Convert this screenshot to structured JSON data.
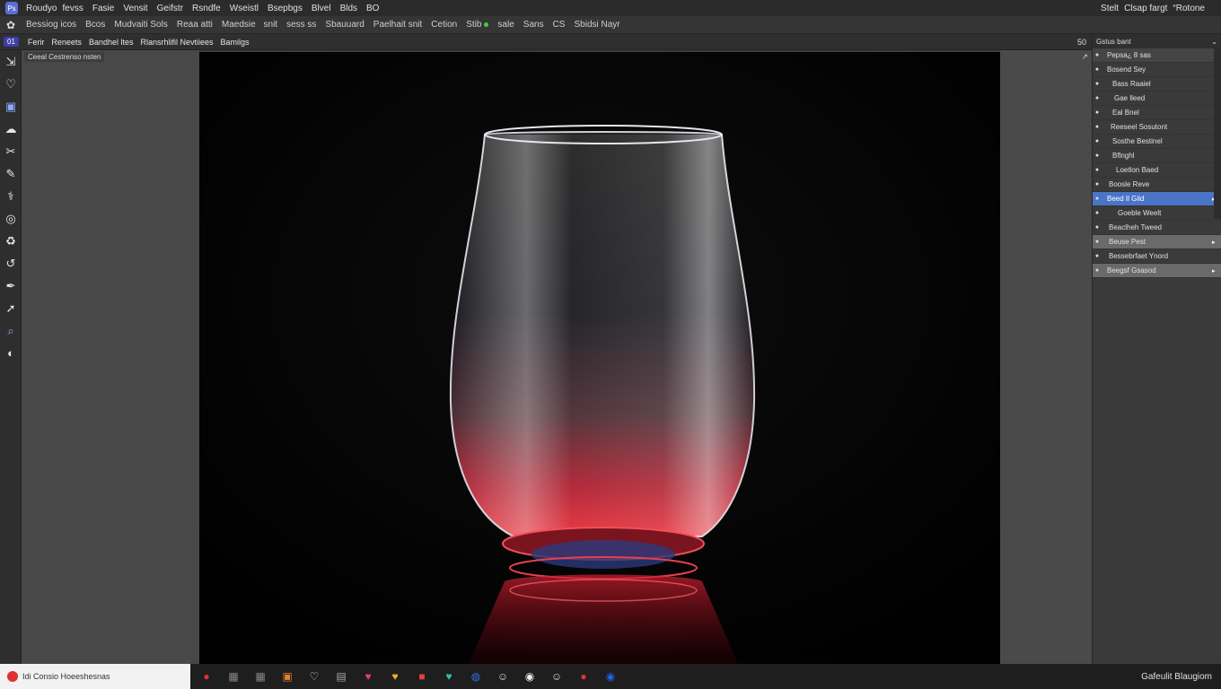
{
  "menubar": {
    "app_icon": "ps-icon",
    "items": [
      "Roudyofevss",
      "Fasie",
      "Vensit",
      "Geifstr",
      "Rsndfe",
      "Wseistl",
      "Bsepbgs",
      "Blvel",
      "Blds",
      "BO"
    ],
    "right": [
      "Stelt",
      "Clsap fargt",
      "“Rotone"
    ]
  },
  "options": {
    "items": [
      "Bessiog icos",
      "Bcos",
      "Mudvaiti Sols",
      "Reaa atti",
      "Maedsie snit",
      "sess ss",
      "Sbauuard",
      "Paelhait snit",
      "Cetion",
      "Stib",
      "sale",
      "Sans",
      "CS",
      "Sbidsi Nayr"
    ]
  },
  "tabs": {
    "doc_tag": "01",
    "items": [
      "Ferir",
      "Reneets",
      "Bandhel ltes",
      "Rlansrhlifil Nevtiiees",
      "Bamilgs"
    ],
    "zoom": "50"
  },
  "left_panel": {
    "tab_label": "Ceeal Cestrenso nsten"
  },
  "right_gap": {
    "corner": "↗"
  },
  "layers": {
    "header": "Gstus bant",
    "rows": [
      {
        "label": "Pepsa¿ 8 sas",
        "style": "head2",
        "indent": 6
      },
      {
        "label": "Bosend Sey",
        "style": "",
        "indent": 6
      },
      {
        "label": "Bass Raaiel",
        "style": "",
        "indent": 12
      },
      {
        "label": "Gae lleed",
        "style": "",
        "indent": 14
      },
      {
        "label": "Eal Bnel",
        "style": "",
        "indent": 12
      },
      {
        "label": "Reeseel Sosutont",
        "style": "",
        "indent": 10
      },
      {
        "label": "Sosthe Bestinel",
        "style": "",
        "indent": 12
      },
      {
        "label": "Bflnghl",
        "style": "",
        "indent": 12
      },
      {
        "label": "Loetlon Baed",
        "style": "",
        "indent": 16
      },
      {
        "label": "Boosle Reve",
        "style": "",
        "indent": 8
      },
      {
        "label": "Beed Il Gild",
        "style": "blue",
        "indent": 6
      },
      {
        "label": "Goeble Weelt",
        "style": "",
        "indent": 18
      },
      {
        "label": "Beaclheh Tweed",
        "style": "",
        "indent": 8
      },
      {
        "label": "Beuse Pest",
        "style": "gray",
        "indent": 8
      },
      {
        "label": "Bessebrfaet Ynord",
        "style": "",
        "indent": 8
      },
      {
        "label": "Beegsf Gsasod",
        "style": "gray",
        "indent": 6
      }
    ]
  },
  "taskbar": {
    "search_text": "Idi Consio Hoeeshesnas",
    "apps": [
      "red-circle-icon",
      "grid-icon",
      "grid2-icon",
      "orange-box-icon",
      "heart-icon",
      "doc-icon",
      "red-heart-icon",
      "yellow-heart-icon",
      "red-square-icon",
      "teal-heart-icon",
      "blue-globe-icon",
      "cat-icon",
      "chat-icon",
      "cat2-icon",
      "red-pin-icon",
      "blue-circle-icon"
    ],
    "tray": "Gafeulit Blaugiom"
  }
}
